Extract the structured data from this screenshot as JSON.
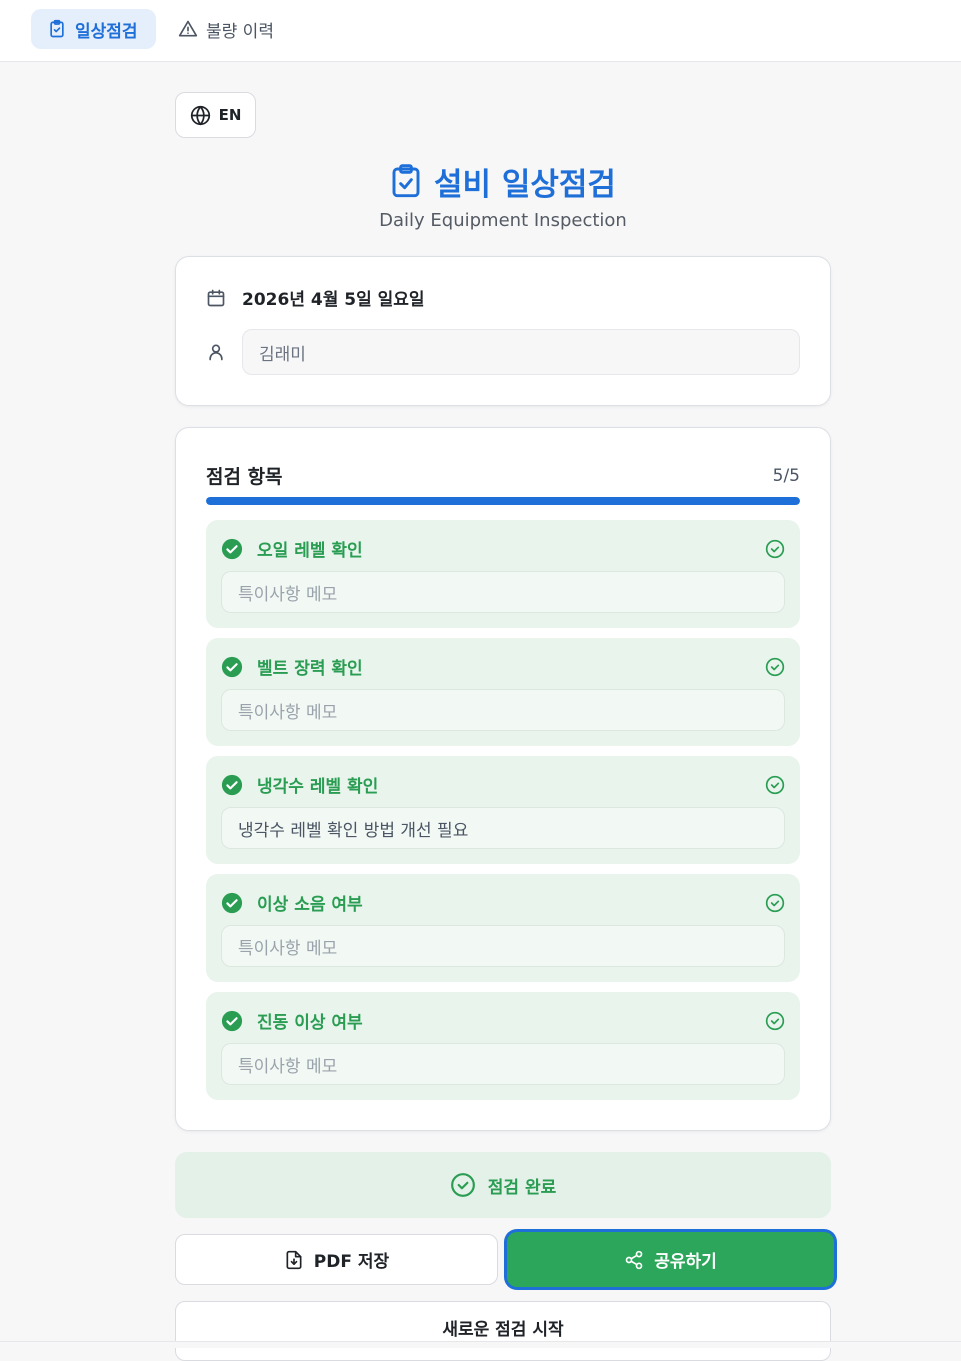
{
  "nav": {
    "tabs": [
      {
        "label": "일상점검",
        "icon": "clipboard-check-icon",
        "active": true
      },
      {
        "label": "불량 이력",
        "icon": "warning-triangle-icon",
        "active": false
      }
    ]
  },
  "language_button": {
    "label": "EN",
    "icon": "globe-icon"
  },
  "header": {
    "title": "설비 일상점검",
    "subtitle": "Daily Equipment Inspection"
  },
  "info": {
    "date": "2026년 4월 5일 일요일",
    "inspector_name": "김래미"
  },
  "checklist": {
    "title": "점검 항목",
    "count": "5/5",
    "progress": 1.0,
    "items": [
      {
        "label": "오일 레벨 확인",
        "memo": "",
        "memo_placeholder": "특이사항 메모",
        "checked": true
      },
      {
        "label": "벨트 장력 확인",
        "memo": "",
        "memo_placeholder": "특이사항 메모",
        "checked": true
      },
      {
        "label": "냉각수 레벨 확인",
        "memo": "냉각수 레벨 확인 방법 개선 필요",
        "memo_placeholder": "특이사항 메모",
        "checked": true
      },
      {
        "label": "이상 소음 여부",
        "memo": "",
        "memo_placeholder": "특이사항 메모",
        "checked": true
      },
      {
        "label": "진동 이상 여부",
        "memo": "",
        "memo_placeholder": "특이사항 메모",
        "checked": true
      }
    ]
  },
  "actions": {
    "complete_label": "점검 완료",
    "pdf_label": "PDF 저장",
    "share_label": "공유하기",
    "new_label": "새로운 점검 시작"
  },
  "colors": {
    "primary_blue": "#1f6fd9",
    "success_green": "#2a9d53",
    "item_bg": "#e8f4ec",
    "share_bg": "#2ca65a"
  }
}
